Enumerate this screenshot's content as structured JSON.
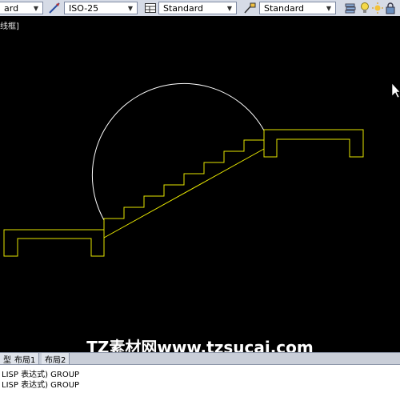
{
  "toolbar": {
    "text_style_value": "ard",
    "dim_style_value": "ISO-25",
    "table_style_value": "Standard",
    "multileader_style_value": "Standard"
  },
  "viewport": {
    "label": "线框]"
  },
  "watermark": {
    "text": "TZ素材网www.tzsucai.com"
  },
  "layout_tabs": [
    "型",
    "布局1",
    "布局2"
  ],
  "command": {
    "lines": [
      "LISP 表达式) GROUP",
      "LISP 表达式) GROUP"
    ]
  },
  "colors": {
    "drawing_yellow": "#e6e600",
    "arc_white": "#ffffff",
    "background": "#000000"
  }
}
